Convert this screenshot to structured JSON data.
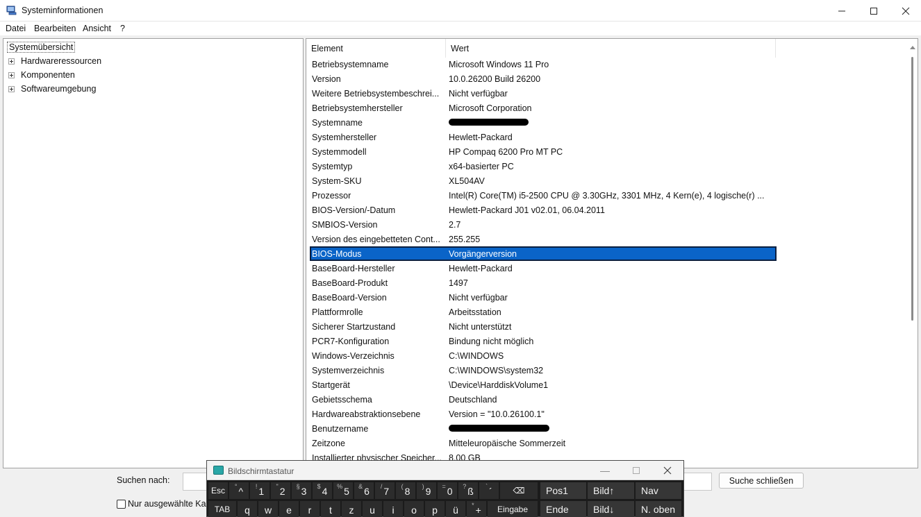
{
  "window": {
    "title": "Systeminformationen",
    "icon": "system-info-icon"
  },
  "menu": {
    "items": [
      {
        "label": "Datei"
      },
      {
        "label": "Bearbeiten"
      },
      {
        "label": "Ansicht"
      },
      {
        "label": "?"
      }
    ]
  },
  "tree": {
    "root": "Systemübersicht",
    "nodes": [
      {
        "label": "Hardwareressourcen"
      },
      {
        "label": "Komponenten"
      },
      {
        "label": "Softwareumgebung"
      }
    ]
  },
  "list": {
    "headers": {
      "element": "Element",
      "wert": "Wert"
    },
    "rows": [
      {
        "element": "Betriebsystemname",
        "wert": "Microsoft Windows 11 Pro"
      },
      {
        "element": "Version",
        "wert": "10.0.26200 Build 26200"
      },
      {
        "element": "Weitere Betriebsystembeschrei...",
        "wert": "Nicht verfügbar"
      },
      {
        "element": "Betriebsystemhersteller",
        "wert": "Microsoft Corporation"
      },
      {
        "element": "Systemname",
        "wert": ""
      },
      {
        "element": "Systemhersteller",
        "wert": "Hewlett-Packard"
      },
      {
        "element": "Systemmodell",
        "wert": "HP Compaq 6200 Pro MT PC"
      },
      {
        "element": "Systemtyp",
        "wert": "x64-basierter PC"
      },
      {
        "element": "System-SKU",
        "wert": "XL504AV"
      },
      {
        "element": "Prozessor",
        "wert": "Intel(R) Core(TM) i5-2500 CPU @ 3.30GHz, 3301 MHz, 4 Kern(e), 4 logische(r) ..."
      },
      {
        "element": "BIOS-Version/-Datum",
        "wert": "Hewlett-Packard J01 v02.01, 06.04.2011"
      },
      {
        "element": "SMBIOS-Version",
        "wert": "2.7"
      },
      {
        "element": "Version des eingebetteten Cont...",
        "wert": "255.255"
      },
      {
        "element": "BIOS-Modus",
        "wert": "Vorgängerversion"
      },
      {
        "element": "BaseBoard-Hersteller",
        "wert": "Hewlett-Packard"
      },
      {
        "element": "BaseBoard-Produkt",
        "wert": "1497"
      },
      {
        "element": "BaseBoard-Version",
        "wert": "Nicht verfügbar"
      },
      {
        "element": "Plattformrolle",
        "wert": "Arbeitsstation"
      },
      {
        "element": "Sicherer Startzustand",
        "wert": "Nicht unterstützt"
      },
      {
        "element": "PCR7-Konfiguration",
        "wert": "Bindung nicht möglich"
      },
      {
        "element": "Windows-Verzeichnis",
        "wert": "C:\\WINDOWS"
      },
      {
        "element": "Systemverzeichnis",
        "wert": "C:\\WINDOWS\\system32"
      },
      {
        "element": "Startgerät",
        "wert": "\\Device\\HarddiskVolume1"
      },
      {
        "element": "Gebietsschema",
        "wert": "Deutschland"
      },
      {
        "element": "Hardwareabstraktionsebene",
        "wert": "Version = \"10.0.26100.1\""
      },
      {
        "element": "Benutzername",
        "wert": ""
      },
      {
        "element": "Zeitzone",
        "wert": "Mitteleuropäische Sommerzeit"
      },
      {
        "element": "Installierter physischer Speicher...",
        "wert": "8,00 GB"
      }
    ],
    "selected_index": 13,
    "selected_color": "#0a64c8"
  },
  "search": {
    "label": "Suchen nach:",
    "value": "",
    "close_button": "Suche schließen",
    "checkbox_label": "Nur ausgewählte Ka",
    "checkbox_checked": false
  },
  "osk": {
    "title": "Bildschirmtastatur",
    "row1": [
      {
        "main": "Esc",
        "sup": ""
      },
      {
        "main": "^",
        "sup": "°"
      },
      {
        "main": "1",
        "sup": "!"
      },
      {
        "main": "2",
        "sup": "\""
      },
      {
        "main": "3",
        "sup": "§"
      },
      {
        "main": "4",
        "sup": "$"
      },
      {
        "main": "5",
        "sup": "%"
      },
      {
        "main": "6",
        "sup": "&"
      },
      {
        "main": "7",
        "sup": "/"
      },
      {
        "main": "8",
        "sup": "("
      },
      {
        "main": "9",
        "sup": ")"
      },
      {
        "main": "0",
        "sup": "="
      },
      {
        "main": "ß",
        "sup": "?"
      },
      {
        "main": "´",
        "sup": "`"
      },
      {
        "main": "⌫",
        "sup": ""
      }
    ],
    "row2": [
      {
        "main": "TAB",
        "sup": ""
      },
      {
        "main": "q",
        "sup": ""
      },
      {
        "main": "w",
        "sup": ""
      },
      {
        "main": "e",
        "sup": ""
      },
      {
        "main": "r",
        "sup": ""
      },
      {
        "main": "t",
        "sup": ""
      },
      {
        "main": "z",
        "sup": ""
      },
      {
        "main": "u",
        "sup": ""
      },
      {
        "main": "i",
        "sup": ""
      },
      {
        "main": "o",
        "sup": ""
      },
      {
        "main": "p",
        "sup": ""
      },
      {
        "main": "ü",
        "sup": ""
      },
      {
        "main": "+",
        "sup": "*"
      },
      {
        "main": "Eingabe",
        "sup": ""
      }
    ],
    "nav_row1": [
      "Pos1",
      "Bild↑",
      "Nav"
    ],
    "nav_row2": [
      "Ende",
      "Bild↓",
      "N. oben"
    ]
  }
}
